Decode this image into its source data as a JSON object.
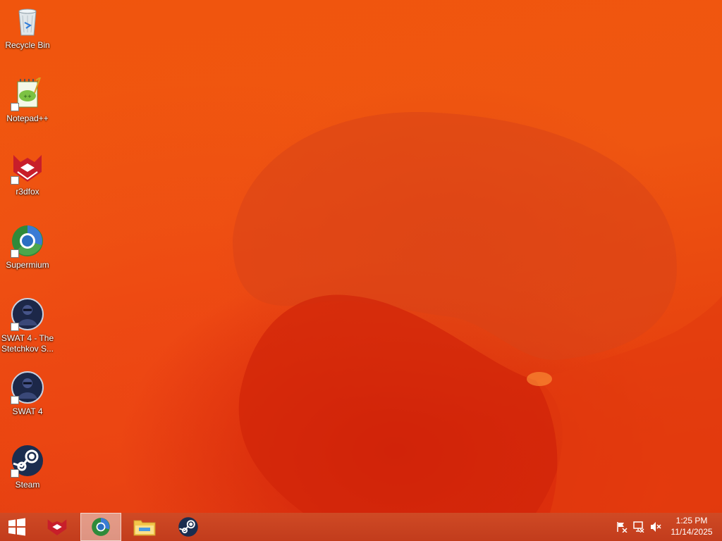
{
  "desktop": {
    "icons": [
      {
        "label": "Recycle Bin",
        "icon": "recycle-bin-icon",
        "shortcut": false
      },
      {
        "label": "Notepad++",
        "icon": "notepad-plus-plus-icon",
        "shortcut": true
      },
      {
        "label": "r3dfox",
        "icon": "r3dfox-icon",
        "shortcut": true
      },
      {
        "label": "Supermium",
        "icon": "supermium-icon",
        "shortcut": true
      },
      {
        "label": "SWAT 4 - The Stetchkov S...",
        "icon": "swat4-stetchkov-icon",
        "shortcut": true
      },
      {
        "label": "SWAT 4",
        "icon": "swat4-icon",
        "shortcut": true
      },
      {
        "label": "Steam",
        "icon": "steam-icon",
        "shortcut": true
      }
    ]
  },
  "taskbar": {
    "start_icon": "windows-start-icon",
    "pinned": [
      {
        "icon": "r3dfox-icon",
        "active": false
      },
      {
        "icon": "supermium-icon",
        "active": true
      },
      {
        "icon": "file-explorer-icon",
        "active": false
      },
      {
        "icon": "steam-icon",
        "active": false
      }
    ],
    "tray": {
      "icons": [
        "action-center-flag-icon",
        "network-icon",
        "volume-muted-icon"
      ]
    },
    "clock": {
      "time": "1:25 PM",
      "date": "11/14/2025"
    }
  },
  "colors": {
    "wallpaper_base": "#ef5611",
    "taskbar": "#c73f1d",
    "label_text": "#ffffff"
  }
}
